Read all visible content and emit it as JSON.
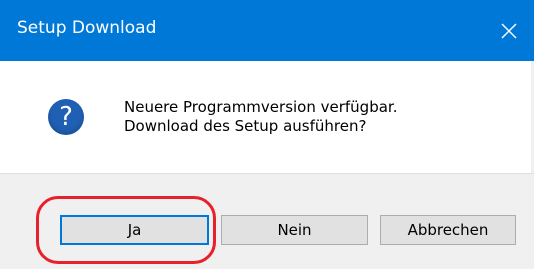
{
  "window": {
    "title": "Setup Download",
    "close_icon": "close-icon"
  },
  "message": {
    "icon": "question-icon",
    "icon_glyph": "?",
    "line1": "Neuere Programmversion verfügbar.",
    "line2": "Download des Setup ausführen?"
  },
  "buttons": {
    "yes": "Ja",
    "no": "Nein",
    "cancel": "Abbrechen"
  },
  "annotation": {
    "highlighted_button": "Ja",
    "color": "#e8202a"
  },
  "colors": {
    "titlebar": "#0078d7",
    "footer": "#f0f0f0",
    "button_face": "#e1e1e1",
    "default_button_border": "#0078d7",
    "question_icon": "#1f5fb4"
  }
}
